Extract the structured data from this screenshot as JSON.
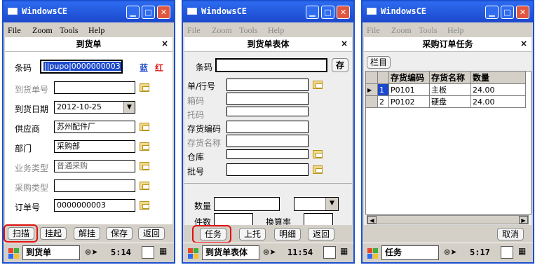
{
  "window_title": "WindowsCE",
  "menu": {
    "file": "File",
    "zoom": "Zoom",
    "tools": "Tools",
    "help": "Help"
  },
  "screen1": {
    "form_title": "到货单",
    "close": "×",
    "barcode_label": "条码",
    "barcode_value": "||pupo|0000000003",
    "blue_tag": "蓝",
    "red_tag": "红",
    "fields": [
      {
        "label": "到货单号",
        "value": ""
      },
      {
        "label": "到货日期",
        "value": "2012-10-25"
      },
      {
        "label": "供应商",
        "value": "苏州配件厂"
      },
      {
        "label": "部门",
        "value": "采购部"
      },
      {
        "label": "业务类型",
        "value": "普通采购"
      },
      {
        "label": "采购类型",
        "value": ""
      },
      {
        "label": "订单号",
        "value": "0000000003"
      }
    ],
    "buttons": [
      "扫描",
      "挂起",
      "解挂",
      "保存",
      "返回"
    ],
    "taskbar_task": "到货单",
    "time": "5:14"
  },
  "screen2": {
    "form_title": "到货单表体",
    "close": "×",
    "barcode_label": "条码",
    "save_btn": "存",
    "fields": [
      {
        "label": "单/行号"
      },
      {
        "label": "箱码"
      },
      {
        "label": "托码"
      },
      {
        "label": "存货编码"
      },
      {
        "label": "存货名称"
      },
      {
        "label": "仓库"
      },
      {
        "label": "批号"
      }
    ],
    "qty_label": "数量",
    "pieces_label": "件数",
    "rate_label": "换算率",
    "buttons": [
      "任务",
      "上托",
      "明细",
      "返回"
    ],
    "taskbar_task": "到货单表体",
    "time": "11:54"
  },
  "screen3": {
    "form_title": "采购订单任务",
    "close": "×",
    "column_btn": "栏目",
    "columns": [
      "存货编码",
      "存货名称",
      "数量"
    ],
    "rows": [
      {
        "n": "1",
        "code": "P0101",
        "name": "主板",
        "qty": "24.00"
      },
      {
        "n": "2",
        "code": "P0102",
        "name": "硬盘",
        "qty": "24.00"
      }
    ],
    "cancel_btn": "取消",
    "taskbar_task": "任务",
    "time": "5:17"
  },
  "colors": {
    "titlebar": "#1b48cc",
    "highlight": "#e01010"
  },
  "icons": [
    "window-icon",
    "minimize-icon",
    "maximize-icon",
    "close-icon",
    "folder-icon",
    "start-flag-icon",
    "network-icon",
    "keyboard-icon"
  ]
}
